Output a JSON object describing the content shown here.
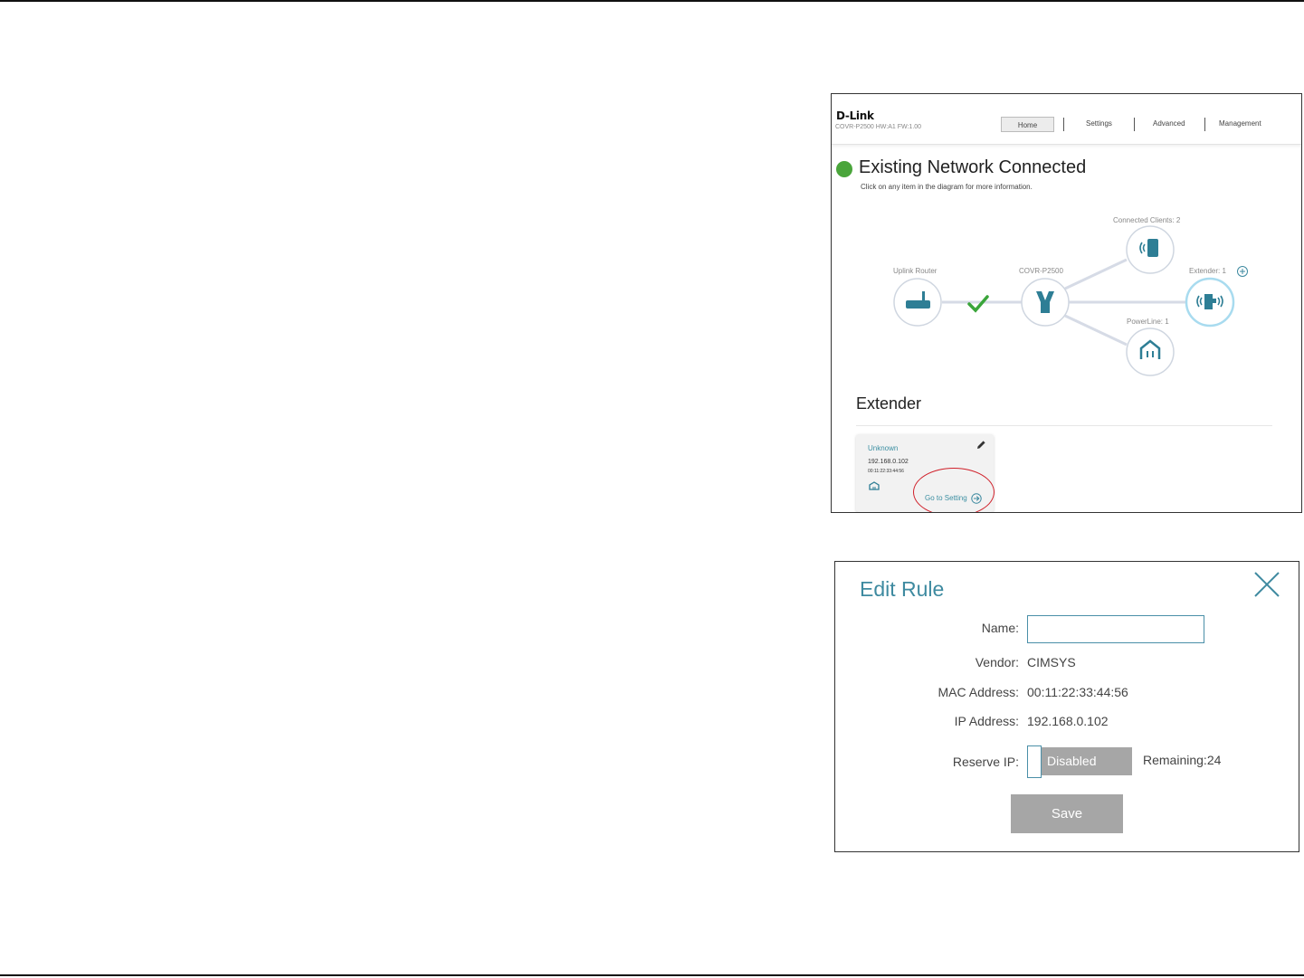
{
  "router_ui": {
    "logo": "D-Link",
    "firmware_info": "COVR-P2500   HW:A1   FW:1.00",
    "nav": [
      "Home",
      "Settings",
      "Advanced",
      "Management"
    ],
    "status": {
      "title": "Existing Network Connected",
      "subtitle": "Click on any item in the diagram for more information."
    },
    "diagram": {
      "uplink_label": "Uplink Router",
      "device_label": "COVR-P2500",
      "clients_label": "Connected Clients: 2",
      "extender_label": "Extender: 1",
      "powerline_label": "PowerLine: 1"
    },
    "extender_section": {
      "title": "Extender",
      "card": {
        "name": "Unknown",
        "ip": "192.168.0.102",
        "mac": "00:11:22:33:44:56",
        "go_to_setting": "Go to Setting"
      }
    }
  },
  "edit_rule": {
    "title": "Edit Rule",
    "name_label": "Name:",
    "name_value": "",
    "vendor_label": "Vendor:",
    "vendor_value": "CIMSYS",
    "mac_label": "MAC Address:",
    "mac_value": "00:11:22:33:44:56",
    "ip_label": "IP Address:",
    "ip_value": "192.168.0.102",
    "reserve_label": "Reserve IP:",
    "reserve_state": "Disabled",
    "remaining": "Remaining:24",
    "save_label": "Save"
  },
  "colors": {
    "accent": "#3e8aa0",
    "status_green": "#4aa53b",
    "highlight_red": "#d0202a",
    "button_gray": "#a6a6a6"
  }
}
